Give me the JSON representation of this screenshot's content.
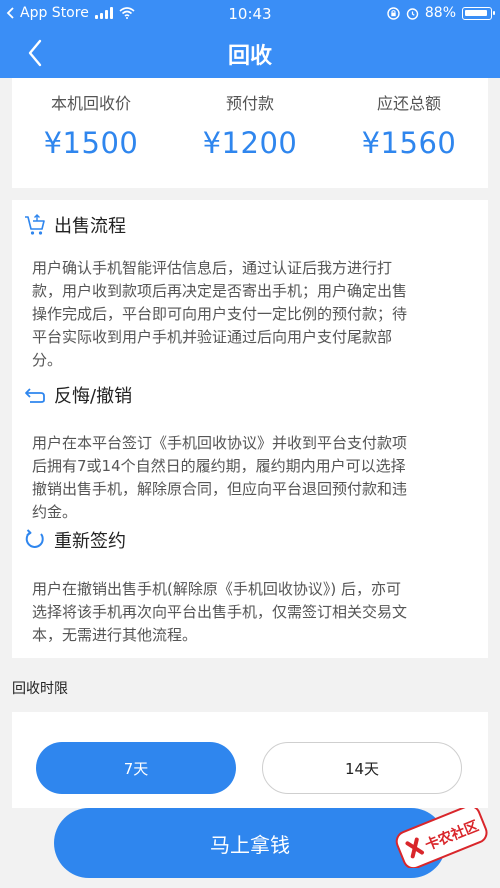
{
  "status_bar": {
    "carrier": "App Store",
    "time": "10:43",
    "battery": "88%"
  },
  "nav": {
    "title": "回收"
  },
  "prices": [
    {
      "label": "本机回收价",
      "value": "¥1500"
    },
    {
      "label": "预付款",
      "value": "¥1200"
    },
    {
      "label": "应还总额",
      "value": "¥1560"
    }
  ],
  "sections": [
    {
      "title": "出售流程",
      "icon": "cart-icon",
      "lines": [
        "用户确认手机智能评估信息后，通过认证后我方进行打",
        "款，用户收到款项后再决定是否寄出手机；用户确定出售",
        "操作完成后，平台即可向用户支付一定比例的预付款；待",
        "平台实际收到用户手机并验证通过后向用户支付尾款部",
        "分。"
      ]
    },
    {
      "title": "反悔/撤销",
      "icon": "undo-icon",
      "lines": [
        "用户在本平台签订《手机回收协议》并收到平台支付款项",
        "后拥有7或14个自然日的履约期，履约期内用户可以选择",
        "撤销出售手机，解除原合同，但应向平台退回预付款和违",
        "约金。"
      ]
    },
    {
      "title": "重新签约",
      "icon": "refresh-icon",
      "lines": [
        "用户在撤销出售手机(解除原《手机回收协议》) 后，亦可",
        "选择将该手机再次向平台出售手机，仅需签订相关交易文",
        "本，无需进行其他流程。"
      ]
    }
  ],
  "limit": {
    "label": "回收时限",
    "options": [
      "7天",
      "14天"
    ],
    "selected": "7天"
  },
  "action_button": "马上拿钱",
  "watermark": "卡农社区",
  "colors": {
    "accent": "#2f86ee",
    "nav_bg": "#3a8ef6",
    "page_bg": "#f2f2f2"
  }
}
